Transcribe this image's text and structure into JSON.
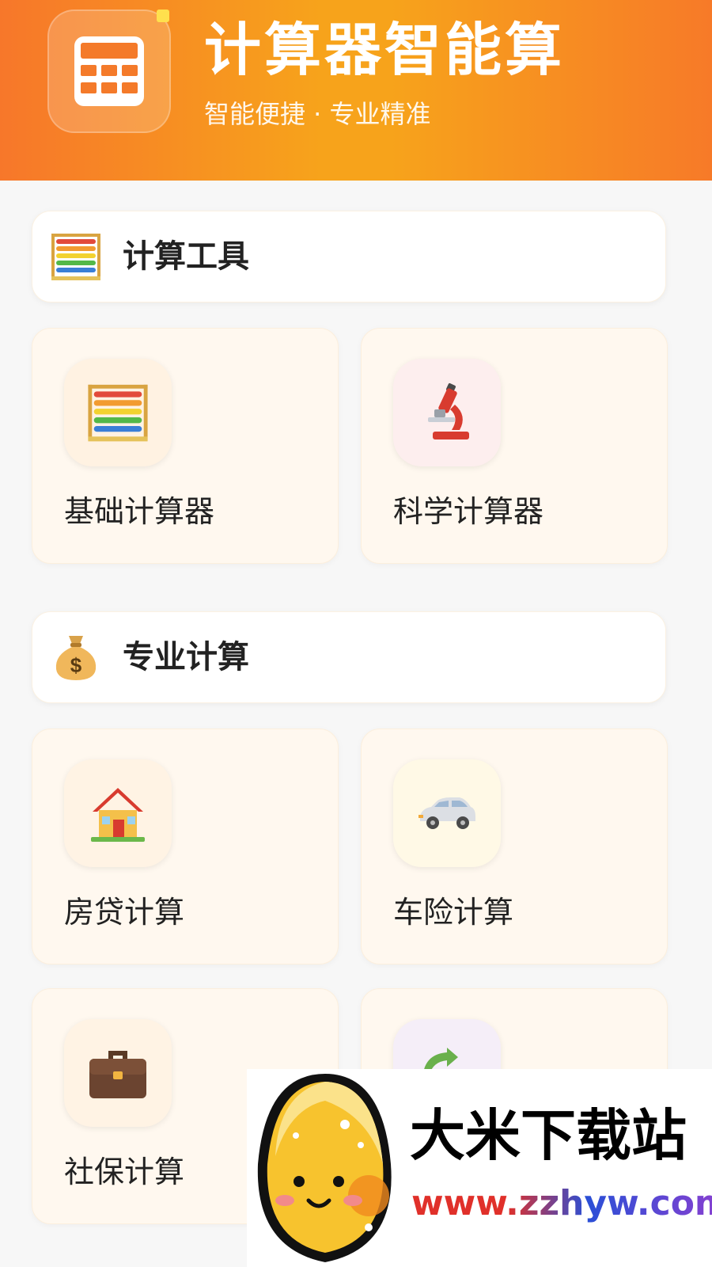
{
  "header": {
    "title": "计算器智能算",
    "subtitle": "智能便捷 · 专业精准",
    "app_icon": "calculator-icon",
    "colors": {
      "gradient_left": "#f7772a",
      "gradient_mid": "#f7a31b",
      "gradient_right": "#f77a28"
    }
  },
  "sections": [
    {
      "title": "计算工具",
      "icon": "abacus-icon",
      "tiles": [
        {
          "label": "基础计算器",
          "icon": "abacus-icon"
        },
        {
          "label": "科学计算器",
          "icon": "microscope-icon"
        }
      ]
    },
    {
      "title": "专业计算",
      "icon": "money-bag-icon",
      "tiles": [
        {
          "label": "房贷计算",
          "icon": "house-icon"
        },
        {
          "label": "车险计算",
          "icon": "car-icon"
        },
        {
          "label": "社保计算",
          "icon": "briefcase-icon"
        },
        {
          "label": "",
          "icon": "currency-exchange-icon"
        }
      ]
    }
  ],
  "watermark": {
    "name": "大米下载站",
    "url": "www.zzhyw.com"
  }
}
